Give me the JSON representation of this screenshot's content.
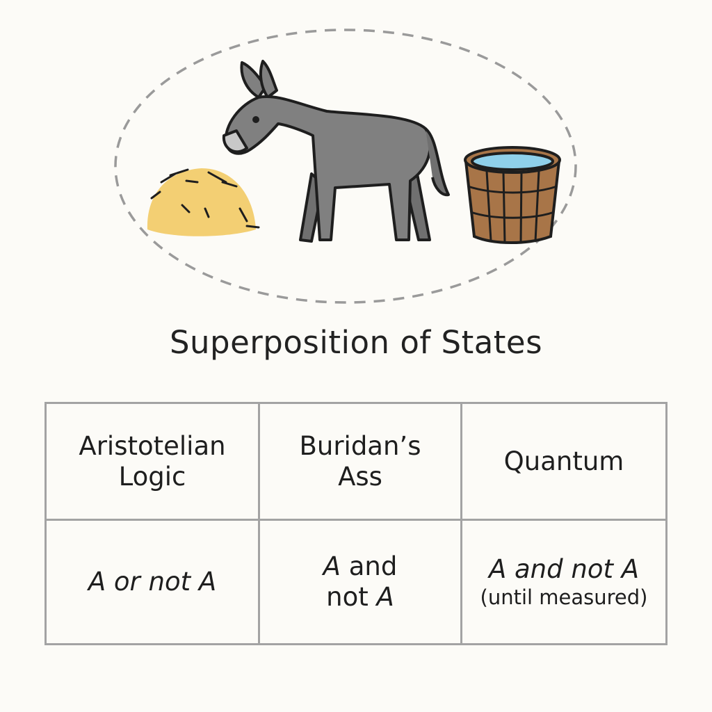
{
  "title": "Superposition of States",
  "illustration": {
    "items": [
      "hay-pile",
      "donkey",
      "water-bucket"
    ],
    "colors": {
      "hay": "#f3cf73",
      "donkey": "#808080",
      "bucket": "#a87548",
      "water": "#8fd0ea",
      "outline": "#1e1e1e",
      "dashed_ellipse": "#9a9a9a"
    }
  },
  "table": {
    "headers": [
      {
        "line1": "Aristotelian",
        "line2": "Logic"
      },
      {
        "line1": "Buridan’s",
        "line2": "Ass"
      },
      {
        "line1": "Quantum",
        "line2": ""
      }
    ],
    "row": {
      "aristotelian": {
        "a1": "A",
        "mid": " or not ",
        "a2": "A"
      },
      "buridan": {
        "a1": "A",
        "mid1": " and",
        "mid2": "not ",
        "a2": "A"
      },
      "quantum": {
        "text": "A and not A",
        "note": "(until measured)"
      }
    }
  }
}
